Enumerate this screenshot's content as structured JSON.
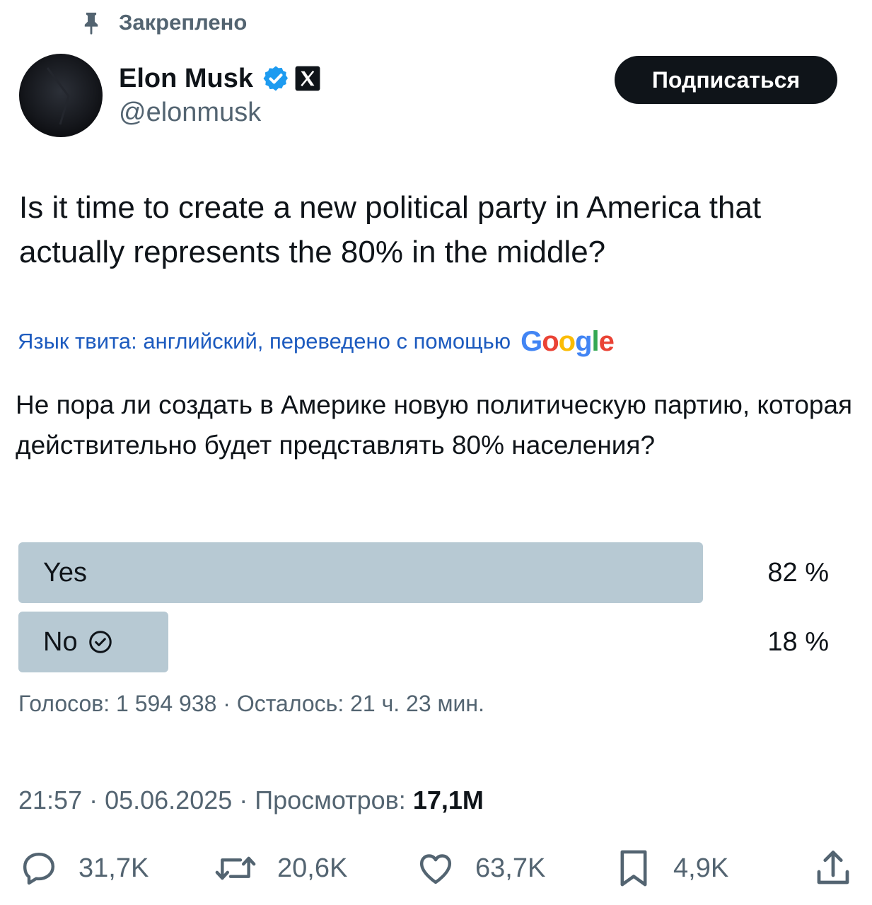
{
  "pinned": {
    "label": "Закреплено",
    "icon": "pin-icon"
  },
  "author": {
    "name": "Elon Musk",
    "handle": "@elonmusk",
    "verified_color": "#1d9bf0",
    "avatar": "avatar-dark-image"
  },
  "follow_button": {
    "label": "Подписаться"
  },
  "tweet": {
    "text": "Is it time to create a new political party in America that actually represents the 80% in the middle?"
  },
  "translation": {
    "note": "Язык твита: английский, переведено с помощью",
    "provider_letters": [
      "G",
      "o",
      "o",
      "g",
      "l",
      "e"
    ],
    "text": "Не пора ли создать в Америке новую политическую партию, которая действительно будет представлять 80% населения?"
  },
  "poll": {
    "options": [
      {
        "label": "Yes",
        "percent_label": "82 %",
        "percent": 82,
        "selected": false
      },
      {
        "label": "No",
        "percent_label": "18 %",
        "percent": 18,
        "selected": true
      }
    ],
    "bar_color": "#b7c9d3",
    "meta": "Голосов: 1 594 938 · Осталось: 21 ч. 23 мин."
  },
  "timestamp": {
    "time_date": "21:57 · 05.06.2025 · Просмотров: ",
    "views": "17,1M"
  },
  "actions": {
    "replies": "31,7K",
    "reposts": "20,6K",
    "likes": "63,7K",
    "bookmarks": "4,9K"
  },
  "colors": {
    "text": "#0f1419",
    "secondary": "#536471",
    "link": "#1d5bbf",
    "follow_bg": "#0f1419"
  }
}
